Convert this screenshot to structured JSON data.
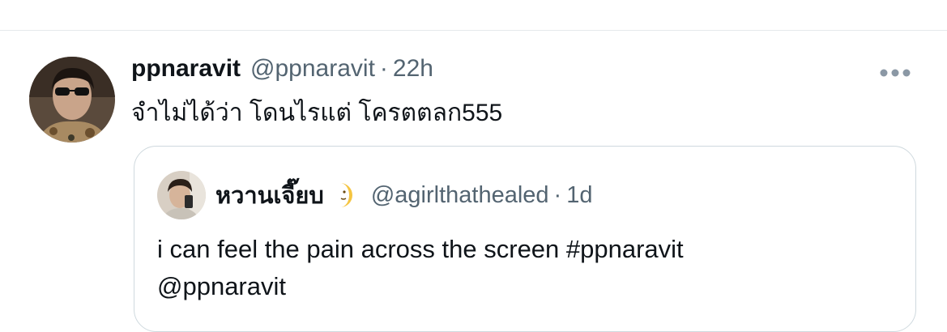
{
  "tweet": {
    "display_name": "ppnaravit",
    "handle": "@ppnaravit",
    "separator": "·",
    "time": "22h",
    "text": "จำไม่ได้ว่า โดนไรแต่ โครตตลก555",
    "more_icon": "more-horizontal-icon"
  },
  "quote": {
    "display_name": "หวานเจี๊ยบ",
    "emoji_icon": "crescent-moon-face-icon",
    "handle": "@agirlthathealed",
    "separator": "·",
    "time": "1d",
    "text_line1": "i can feel the pain across the screen #ppnaravit",
    "text_line2": "@ppnaravit"
  },
  "colors": {
    "text_primary": "#0f1419",
    "text_secondary": "#536471",
    "border": "#cfd9de",
    "divider": "#e6e9ec"
  }
}
